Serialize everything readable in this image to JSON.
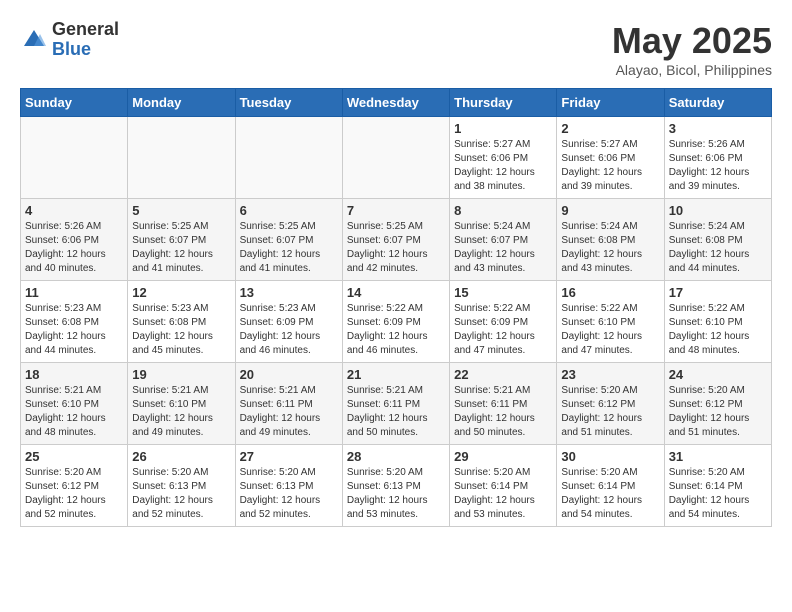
{
  "header": {
    "logo_general": "General",
    "logo_blue": "Blue",
    "month": "May 2025",
    "location": "Alayao, Bicol, Philippines"
  },
  "weekdays": [
    "Sunday",
    "Monday",
    "Tuesday",
    "Wednesday",
    "Thursday",
    "Friday",
    "Saturday"
  ],
  "weeks": [
    [
      {
        "day": "",
        "info": ""
      },
      {
        "day": "",
        "info": ""
      },
      {
        "day": "",
        "info": ""
      },
      {
        "day": "",
        "info": ""
      },
      {
        "day": "1",
        "info": "Sunrise: 5:27 AM\nSunset: 6:06 PM\nDaylight: 12 hours\nand 38 minutes."
      },
      {
        "day": "2",
        "info": "Sunrise: 5:27 AM\nSunset: 6:06 PM\nDaylight: 12 hours\nand 39 minutes."
      },
      {
        "day": "3",
        "info": "Sunrise: 5:26 AM\nSunset: 6:06 PM\nDaylight: 12 hours\nand 39 minutes."
      }
    ],
    [
      {
        "day": "4",
        "info": "Sunrise: 5:26 AM\nSunset: 6:06 PM\nDaylight: 12 hours\nand 40 minutes."
      },
      {
        "day": "5",
        "info": "Sunrise: 5:25 AM\nSunset: 6:07 PM\nDaylight: 12 hours\nand 41 minutes."
      },
      {
        "day": "6",
        "info": "Sunrise: 5:25 AM\nSunset: 6:07 PM\nDaylight: 12 hours\nand 41 minutes."
      },
      {
        "day": "7",
        "info": "Sunrise: 5:25 AM\nSunset: 6:07 PM\nDaylight: 12 hours\nand 42 minutes."
      },
      {
        "day": "8",
        "info": "Sunrise: 5:24 AM\nSunset: 6:07 PM\nDaylight: 12 hours\nand 43 minutes."
      },
      {
        "day": "9",
        "info": "Sunrise: 5:24 AM\nSunset: 6:08 PM\nDaylight: 12 hours\nand 43 minutes."
      },
      {
        "day": "10",
        "info": "Sunrise: 5:24 AM\nSunset: 6:08 PM\nDaylight: 12 hours\nand 44 minutes."
      }
    ],
    [
      {
        "day": "11",
        "info": "Sunrise: 5:23 AM\nSunset: 6:08 PM\nDaylight: 12 hours\nand 44 minutes."
      },
      {
        "day": "12",
        "info": "Sunrise: 5:23 AM\nSunset: 6:08 PM\nDaylight: 12 hours\nand 45 minutes."
      },
      {
        "day": "13",
        "info": "Sunrise: 5:23 AM\nSunset: 6:09 PM\nDaylight: 12 hours\nand 46 minutes."
      },
      {
        "day": "14",
        "info": "Sunrise: 5:22 AM\nSunset: 6:09 PM\nDaylight: 12 hours\nand 46 minutes."
      },
      {
        "day": "15",
        "info": "Sunrise: 5:22 AM\nSunset: 6:09 PM\nDaylight: 12 hours\nand 47 minutes."
      },
      {
        "day": "16",
        "info": "Sunrise: 5:22 AM\nSunset: 6:10 PM\nDaylight: 12 hours\nand 47 minutes."
      },
      {
        "day": "17",
        "info": "Sunrise: 5:22 AM\nSunset: 6:10 PM\nDaylight: 12 hours\nand 48 minutes."
      }
    ],
    [
      {
        "day": "18",
        "info": "Sunrise: 5:21 AM\nSunset: 6:10 PM\nDaylight: 12 hours\nand 48 minutes."
      },
      {
        "day": "19",
        "info": "Sunrise: 5:21 AM\nSunset: 6:10 PM\nDaylight: 12 hours\nand 49 minutes."
      },
      {
        "day": "20",
        "info": "Sunrise: 5:21 AM\nSunset: 6:11 PM\nDaylight: 12 hours\nand 49 minutes."
      },
      {
        "day": "21",
        "info": "Sunrise: 5:21 AM\nSunset: 6:11 PM\nDaylight: 12 hours\nand 50 minutes."
      },
      {
        "day": "22",
        "info": "Sunrise: 5:21 AM\nSunset: 6:11 PM\nDaylight: 12 hours\nand 50 minutes."
      },
      {
        "day": "23",
        "info": "Sunrise: 5:20 AM\nSunset: 6:12 PM\nDaylight: 12 hours\nand 51 minutes."
      },
      {
        "day": "24",
        "info": "Sunrise: 5:20 AM\nSunset: 6:12 PM\nDaylight: 12 hours\nand 51 minutes."
      }
    ],
    [
      {
        "day": "25",
        "info": "Sunrise: 5:20 AM\nSunset: 6:12 PM\nDaylight: 12 hours\nand 52 minutes."
      },
      {
        "day": "26",
        "info": "Sunrise: 5:20 AM\nSunset: 6:13 PM\nDaylight: 12 hours\nand 52 minutes."
      },
      {
        "day": "27",
        "info": "Sunrise: 5:20 AM\nSunset: 6:13 PM\nDaylight: 12 hours\nand 52 minutes."
      },
      {
        "day": "28",
        "info": "Sunrise: 5:20 AM\nSunset: 6:13 PM\nDaylight: 12 hours\nand 53 minutes."
      },
      {
        "day": "29",
        "info": "Sunrise: 5:20 AM\nSunset: 6:14 PM\nDaylight: 12 hours\nand 53 minutes."
      },
      {
        "day": "30",
        "info": "Sunrise: 5:20 AM\nSunset: 6:14 PM\nDaylight: 12 hours\nand 54 minutes."
      },
      {
        "day": "31",
        "info": "Sunrise: 5:20 AM\nSunset: 6:14 PM\nDaylight: 12 hours\nand 54 minutes."
      }
    ]
  ]
}
